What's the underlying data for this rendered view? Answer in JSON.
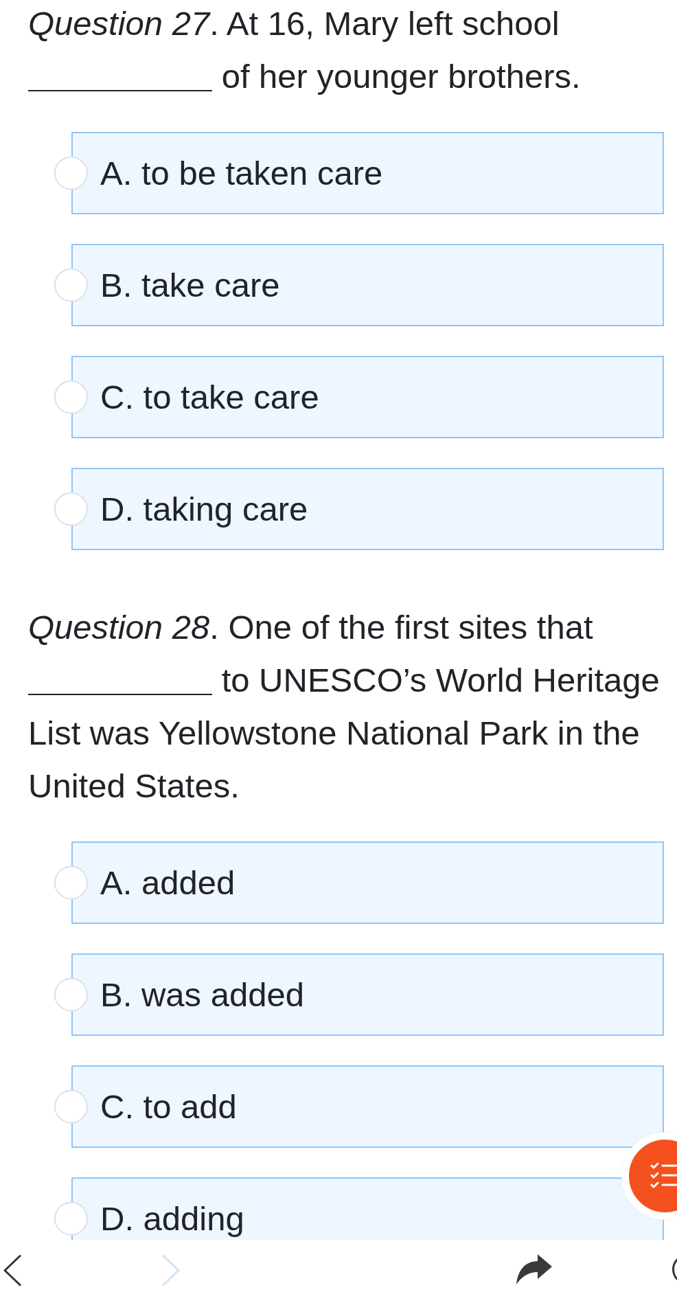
{
  "questions": [
    {
      "text_before_blank": "*Question 27*. At 16, Mary left school",
      "text_after_blank": "of her younger brothers.",
      "options": [
        {
          "label": "A. to be taken care",
          "selected": false
        },
        {
          "label": "B. take care",
          "selected": false
        },
        {
          "label": "C. to take care",
          "selected": false
        },
        {
          "label": "D. taking care",
          "selected": false
        }
      ]
    },
    {
      "text_before_blank": "*Question 28*. One of the first sites that",
      "text_after_blank": "to UNESCO’s World Heritage List was Yellowstone National Park in the United States.",
      "options": [
        {
          "label": "A. added",
          "selected": false
        },
        {
          "label": "B. was added",
          "selected": false
        },
        {
          "label": "C. to add",
          "selected": false
        },
        {
          "label": "D. adding",
          "selected": false
        }
      ]
    }
  ],
  "toolbar": [
    {
      "kind": "back",
      "disabled": false
    },
    {
      "kind": "forward",
      "disabled": true
    },
    {
      "kind": "share",
      "disabled": false
    },
    {
      "kind": "circle",
      "disabled": false
    }
  ]
}
